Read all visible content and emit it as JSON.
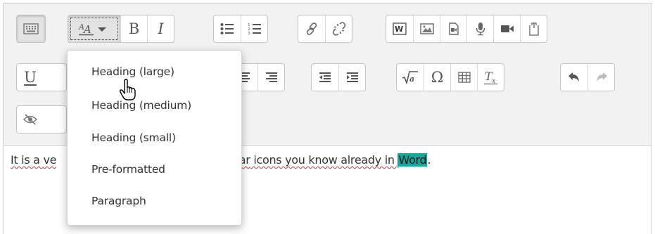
{
  "toolbar": {
    "row1": [
      {
        "group": "toolbar-toggle",
        "buttons": [
          {
            "icon": "toolbar-toggle-icon",
            "active": true
          }
        ]
      },
      {
        "group": "text-style",
        "buttons": [
          {
            "icon": "paragraph-styles-icon",
            "focused": true
          },
          {
            "icon": "bold-icon",
            "glyph": "B"
          },
          {
            "icon": "italic-icon",
            "glyph": "I"
          }
        ]
      },
      {
        "group": "lists",
        "buttons": [
          {
            "icon": "unordered-list-icon"
          },
          {
            "icon": "ordered-list-icon"
          }
        ]
      },
      {
        "group": "links",
        "buttons": [
          {
            "icon": "link-icon"
          },
          {
            "icon": "unlink-icon"
          }
        ]
      },
      {
        "group": "media",
        "buttons": [
          {
            "icon": "word-paste-icon"
          },
          {
            "icon": "image-icon"
          },
          {
            "icon": "media-file-icon"
          },
          {
            "icon": "record-audio-icon"
          },
          {
            "icon": "record-video-icon"
          },
          {
            "icon": "manage-files-icon"
          }
        ]
      }
    ],
    "row2": [
      {
        "group": "underline",
        "buttons": [
          {
            "icon": "underline-icon",
            "glyph": "U"
          }
        ]
      },
      {
        "group": "align",
        "buttons": [
          {
            "icon": "align-center-icon"
          },
          {
            "icon": "align-right-icon"
          }
        ]
      },
      {
        "group": "indent",
        "buttons": [
          {
            "icon": "outdent-icon"
          },
          {
            "icon": "indent-icon"
          }
        ]
      },
      {
        "group": "insert",
        "buttons": [
          {
            "icon": "equation-icon"
          },
          {
            "icon": "special-character-icon",
            "glyph": "Ω"
          },
          {
            "icon": "table-icon"
          },
          {
            "icon": "clear-formatting-icon"
          }
        ]
      },
      {
        "group": "history",
        "buttons": [
          {
            "icon": "undo-icon"
          },
          {
            "icon": "redo-icon",
            "disabled": true
          }
        ]
      }
    ],
    "row3": [
      {
        "group": "accessibility",
        "buttons": [
          {
            "icon": "accessibility-checker-icon"
          }
        ]
      }
    ]
  },
  "dropdown": {
    "items": [
      "Heading (large)",
      "Heading (medium)",
      "Heading (small)",
      "Pre-formatted",
      "Paragraph"
    ]
  },
  "content": {
    "visible_start": "It is a ",
    "visible_start_spelled": "ve",
    "visible_end_pre": "milar",
    "visible_end_mid": " icons you know already in ",
    "highlight": "Word",
    "trailing": "."
  },
  "colors": {
    "highlight": "#16a89a",
    "spellcheck": "#e0302e"
  }
}
